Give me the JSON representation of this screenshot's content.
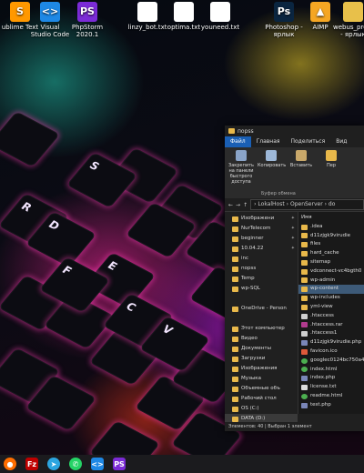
{
  "desktop_icons": [
    {
      "label": "ublime Text",
      "icon": "sublime-text-icon",
      "color": "#ff9800",
      "glyph": "S"
    },
    {
      "label": "Visual Studio Code",
      "icon": "vscode-icon",
      "color": "#1e88e5",
      "glyph": "<>"
    },
    {
      "label": "PhpStorm 2020.1",
      "icon": "phpstorm-icon",
      "color": "#7b2bd6",
      "glyph": "PS"
    },
    {
      "label": "linzy_bot.txt",
      "icon": "text-file-icon",
      "color": "#ffffff",
      "glyph": ""
    },
    {
      "label": "optima.txt",
      "icon": "text-file-icon",
      "color": "#ffffff",
      "glyph": ""
    },
    {
      "label": "youneed.txt",
      "icon": "text-file-icon",
      "color": "#ffffff",
      "glyph": ""
    },
    {
      "label": "Photoshop - ярлык",
      "icon": "photoshop-icon",
      "color": "#0a2540",
      "glyph": "Ps"
    },
    {
      "label": "AIMP",
      "icon": "aimp-icon",
      "color": "#f5a623",
      "glyph": "▲"
    },
    {
      "label": "webus_proj... - ярлык",
      "icon": "folder-zip-icon",
      "color": "#e8c04a",
      "glyph": ""
    }
  ],
  "keys": [
    "S",
    "R",
    "D",
    "E",
    "F",
    "C",
    "V"
  ],
  "explorer": {
    "title": "порѕѕ",
    "tabs": [
      "Файл",
      "Главная",
      "Поделиться",
      "Вид"
    ],
    "ribbon": {
      "pin_label": "Закрепить на панели быстрого доступа",
      "copy_label": "Копировать",
      "paste_label": "Вставить",
      "group_label": "Буфер обмена",
      "extra_label": "Пер"
    },
    "address": {
      "parts": [
        "LokalHost",
        "OpenServer",
        "do"
      ],
      "separator": "›"
    },
    "nav_items": [
      {
        "label": "Изображени",
        "pinned": true
      },
      {
        "label": "NurTelecom",
        "pinned": true
      },
      {
        "label": "beginner",
        "pinned": true
      },
      {
        "label": "10.04.22",
        "pinned": true
      },
      {
        "label": "inc",
        "pinned": false
      },
      {
        "label": "порѕѕ",
        "pinned": false
      },
      {
        "label": "Temp",
        "pinned": false
      },
      {
        "label": "wp-SQL",
        "pinned": false
      },
      {
        "label": "",
        "pinned": false
      },
      {
        "label": "OneDrive - Person",
        "pinned": false
      },
      {
        "label": "",
        "pinned": false
      },
      {
        "label": "Этот компьютер",
        "pinned": false
      },
      {
        "label": "Видео",
        "pinned": false
      },
      {
        "label": "Документы",
        "pinned": false
      },
      {
        "label": "Загрузки",
        "pinned": false
      },
      {
        "label": "Изображения",
        "pinned": false
      },
      {
        "label": "Музыка",
        "pinned": false
      },
      {
        "label": "Объемные объ",
        "pinned": false
      },
      {
        "label": "Рабочий стол",
        "pinned": false
      },
      {
        "label": "OS (C:)",
        "pinned": false
      },
      {
        "label": "DATA (D:)",
        "pinned": false
      }
    ],
    "files_header": "Имя",
    "files": [
      {
        "name": ".idea",
        "type": "folder"
      },
      {
        "name": "d11zjgk9virudie",
        "type": "folder"
      },
      {
        "name": "files",
        "type": "folder"
      },
      {
        "name": "hard_cache",
        "type": "folder"
      },
      {
        "name": "sitemap",
        "type": "folder"
      },
      {
        "name": "vdconnect-vc4bgth0",
        "type": "folder"
      },
      {
        "name": "wp-admin",
        "type": "folder"
      },
      {
        "name": "wp-content",
        "type": "folder"
      },
      {
        "name": "wp-includes",
        "type": "folder"
      },
      {
        "name": "yml-view",
        "type": "folder"
      },
      {
        "name": ".htaccess",
        "type": "file"
      },
      {
        "name": ".htaccess.rar",
        "type": "archive"
      },
      {
        "name": ".htaccess1",
        "type": "file"
      },
      {
        "name": "d11zjgk9virudie.php",
        "type": "php"
      },
      {
        "name": "favicon.ico",
        "type": "ico"
      },
      {
        "name": "googlec0124bc750a44",
        "type": "chrome"
      },
      {
        "name": "index.html",
        "type": "chrome"
      },
      {
        "name": "index.php",
        "type": "php"
      },
      {
        "name": "license.txt",
        "type": "text"
      },
      {
        "name": "readme.html",
        "type": "chrome"
      },
      {
        "name": "test.php",
        "type": "php"
      }
    ],
    "status": "Элементов: 40  |  Выбран 1 элемент"
  },
  "taskbar": [
    {
      "icon": "firefox-icon",
      "color": "#ff6d00",
      "glyph": "●"
    },
    {
      "icon": "filezilla-icon",
      "color": "#bf0000",
      "glyph": "Fz"
    },
    {
      "icon": "telegram-icon",
      "color": "#2ca5e0",
      "glyph": "➤"
    },
    {
      "icon": "whatsapp-icon",
      "color": "#25d366",
      "glyph": "✆"
    },
    {
      "icon": "vscode-icon",
      "color": "#1e88e5",
      "glyph": "<>"
    },
    {
      "icon": "phpstorm-icon",
      "color": "#7b2bd6",
      "glyph": "PS"
    }
  ]
}
